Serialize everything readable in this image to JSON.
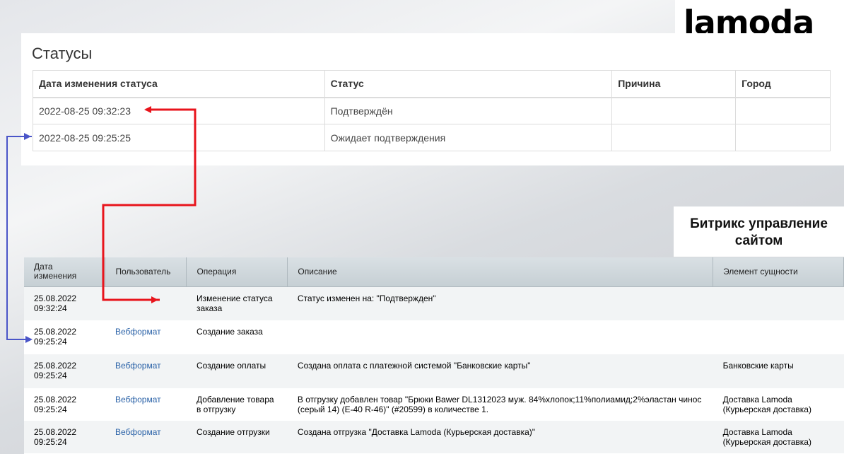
{
  "logo": {
    "text": "lamoda"
  },
  "statuses": {
    "title": "Статусы",
    "columns": [
      "Дата изменения статуса",
      "Статус",
      "Причина",
      "Город"
    ],
    "rows": [
      {
        "date": "2022-08-25 09:32:23",
        "status": "Подтверждён",
        "reason": "",
        "city": ""
      },
      {
        "date": "2022-08-25 09:25:25",
        "status": "Ожидает подтверждения",
        "reason": "",
        "city": ""
      }
    ]
  },
  "bitrix_label": {
    "line1": "Битрикс управление",
    "line2": "сайтом"
  },
  "bitrix": {
    "columns": [
      "Дата изменения",
      "Пользователь",
      "Операция",
      "Описание",
      "Элемент сущности"
    ],
    "rows": [
      {
        "date": "25.08.2022",
        "time": "09:32:24",
        "user": "",
        "operation": "Изменение статуса заказа",
        "description": "Статус изменен на: \"Подтвержден\"",
        "entity": ""
      },
      {
        "date": "25.08.2022",
        "time": "09:25:24",
        "user": "Вебформат",
        "operation": "Создание заказа",
        "description": "",
        "entity": ""
      },
      {
        "date": "25.08.2022",
        "time": "09:25:24",
        "user": "Вебформат",
        "operation": "Создание оплаты",
        "description": "Создана оплата с платежной системой \"Банковские карты\"",
        "entity": "Банковские карты"
      },
      {
        "date": "25.08.2022",
        "time": "09:25:24",
        "user": "Вебформат",
        "operation": "Добавление товара в отгрузку",
        "description": "В отгрузку добавлен товар \"Брюки Bawer DL1312023 муж. 84%хлопок;11%полиамид;2%эластан чинос (серый 14) (E-40 R-46)\" (#20599) в количестве 1.",
        "entity": "Доставка Lamoda (Курьерская доставка)"
      },
      {
        "date": "25.08.2022",
        "time": "09:25:24",
        "user": "Вебформат",
        "operation": "Создание отгрузки",
        "description": "Создана отгрузка \"Доставка Lamoda (Курьерская доставка)\"",
        "entity": "Доставка Lamoda (Курьерская доставка)"
      }
    ]
  },
  "colors": {
    "arrow_red": "#e8141c",
    "arrow_blue": "#4a55c8",
    "link": "#2c63a8"
  }
}
